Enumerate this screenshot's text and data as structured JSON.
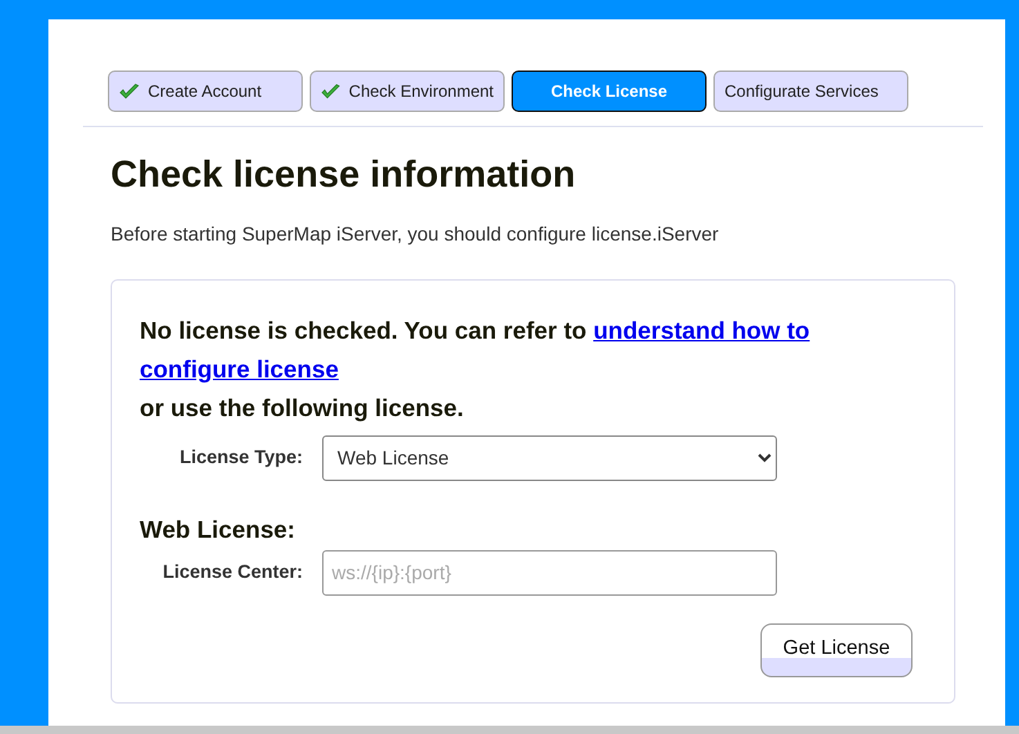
{
  "steps": [
    {
      "label": "Create Account",
      "done": true,
      "selected": false
    },
    {
      "label": "Check Environment",
      "done": true,
      "selected": false
    },
    {
      "label": "Check License",
      "done": false,
      "selected": true
    },
    {
      "label": "Configurate Services",
      "done": false,
      "selected": false
    }
  ],
  "heading": "Check license information",
  "intro": "Before starting SuperMap iServer, you should configure license.iServer",
  "notice": {
    "text": "No license is checked. You can refer to",
    "link_lines": [
      "understand how to",
      "configure license"
    ],
    "after": "or use the following license."
  },
  "license_type": {
    "label": "License Type:",
    "value": "Web License"
  },
  "section": "Web License:",
  "license_center": {
    "label": "License Center:",
    "placeholder": "ws://{ip}:{port}"
  },
  "button": "Get License"
}
